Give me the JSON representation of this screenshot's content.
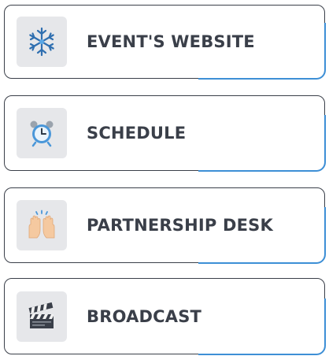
{
  "menu": {
    "items": [
      {
        "label": "EVENT'S WEBSITE",
        "icon": "snowflake-icon"
      },
      {
        "label": "SCHEDULE",
        "icon": "alarm-clock-icon"
      },
      {
        "label": "PARTNERSHIP DESK",
        "icon": "raising-hands-icon"
      },
      {
        "label": "BROADCAST",
        "icon": "clapper-board-icon"
      }
    ]
  },
  "colors": {
    "text": "#3a3f49",
    "border": "#3a3f49",
    "accent": "#3d8fd6",
    "icon_tile": "#e6e7ea"
  }
}
